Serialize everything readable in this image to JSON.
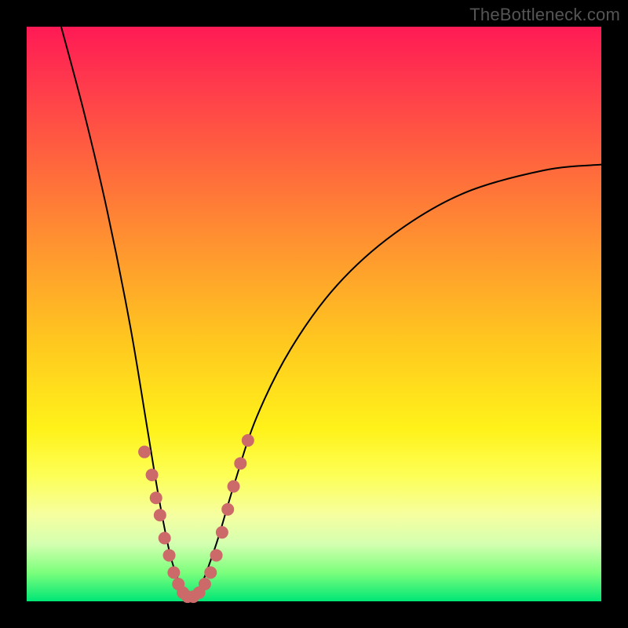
{
  "watermark": "TheBottleneck.com",
  "colors": {
    "gradient_top": "#ff1a55",
    "gradient_mid": "#fff21a",
    "gradient_bottom": "#00e676",
    "curve": "#000000",
    "dots": "#cc6a6a",
    "frame": "#000000"
  },
  "chart_data": {
    "type": "line",
    "title": "",
    "xlabel": "",
    "ylabel": "",
    "xlim": [
      0,
      100
    ],
    "ylim": [
      0,
      100
    ],
    "note": "Values read as (x%, y%) of the plot area, origin bottom-left. Single V-shaped curve with minimum near x≈28, y≈0; left branch rises to y=100 at x≈6; right branch rises and exits right edge near y≈76.",
    "series": [
      {
        "name": "curve",
        "points": [
          {
            "x": 6,
            "y": 100
          },
          {
            "x": 10,
            "y": 85
          },
          {
            "x": 14,
            "y": 68
          },
          {
            "x": 18,
            "y": 48
          },
          {
            "x": 21,
            "y": 30
          },
          {
            "x": 23,
            "y": 18
          },
          {
            "x": 25,
            "y": 8
          },
          {
            "x": 27,
            "y": 2
          },
          {
            "x": 28,
            "y": 0
          },
          {
            "x": 30,
            "y": 2
          },
          {
            "x": 33,
            "y": 10
          },
          {
            "x": 36,
            "y": 20
          },
          {
            "x": 40,
            "y": 32
          },
          {
            "x": 46,
            "y": 44
          },
          {
            "x": 54,
            "y": 55
          },
          {
            "x": 64,
            "y": 64
          },
          {
            "x": 76,
            "y": 71
          },
          {
            "x": 90,
            "y": 75
          },
          {
            "x": 100,
            "y": 76
          }
        ]
      }
    ],
    "dots": [
      {
        "x": 20.5,
        "y": 26
      },
      {
        "x": 21.8,
        "y": 22
      },
      {
        "x": 22.5,
        "y": 18
      },
      {
        "x": 23.2,
        "y": 15
      },
      {
        "x": 24.0,
        "y": 11
      },
      {
        "x": 24.8,
        "y": 8
      },
      {
        "x": 25.6,
        "y": 5
      },
      {
        "x": 26.4,
        "y": 3
      },
      {
        "x": 27.2,
        "y": 1.5
      },
      {
        "x": 28.0,
        "y": 0.8
      },
      {
        "x": 29.0,
        "y": 0.8
      },
      {
        "x": 30.0,
        "y": 1.5
      },
      {
        "x": 31.0,
        "y": 3
      },
      {
        "x": 32.0,
        "y": 5
      },
      {
        "x": 33.0,
        "y": 8
      },
      {
        "x": 34.0,
        "y": 12
      },
      {
        "x": 35.0,
        "y": 16
      },
      {
        "x": 36.0,
        "y": 20
      },
      {
        "x": 37.2,
        "y": 24
      },
      {
        "x": 38.5,
        "y": 28
      }
    ]
  }
}
